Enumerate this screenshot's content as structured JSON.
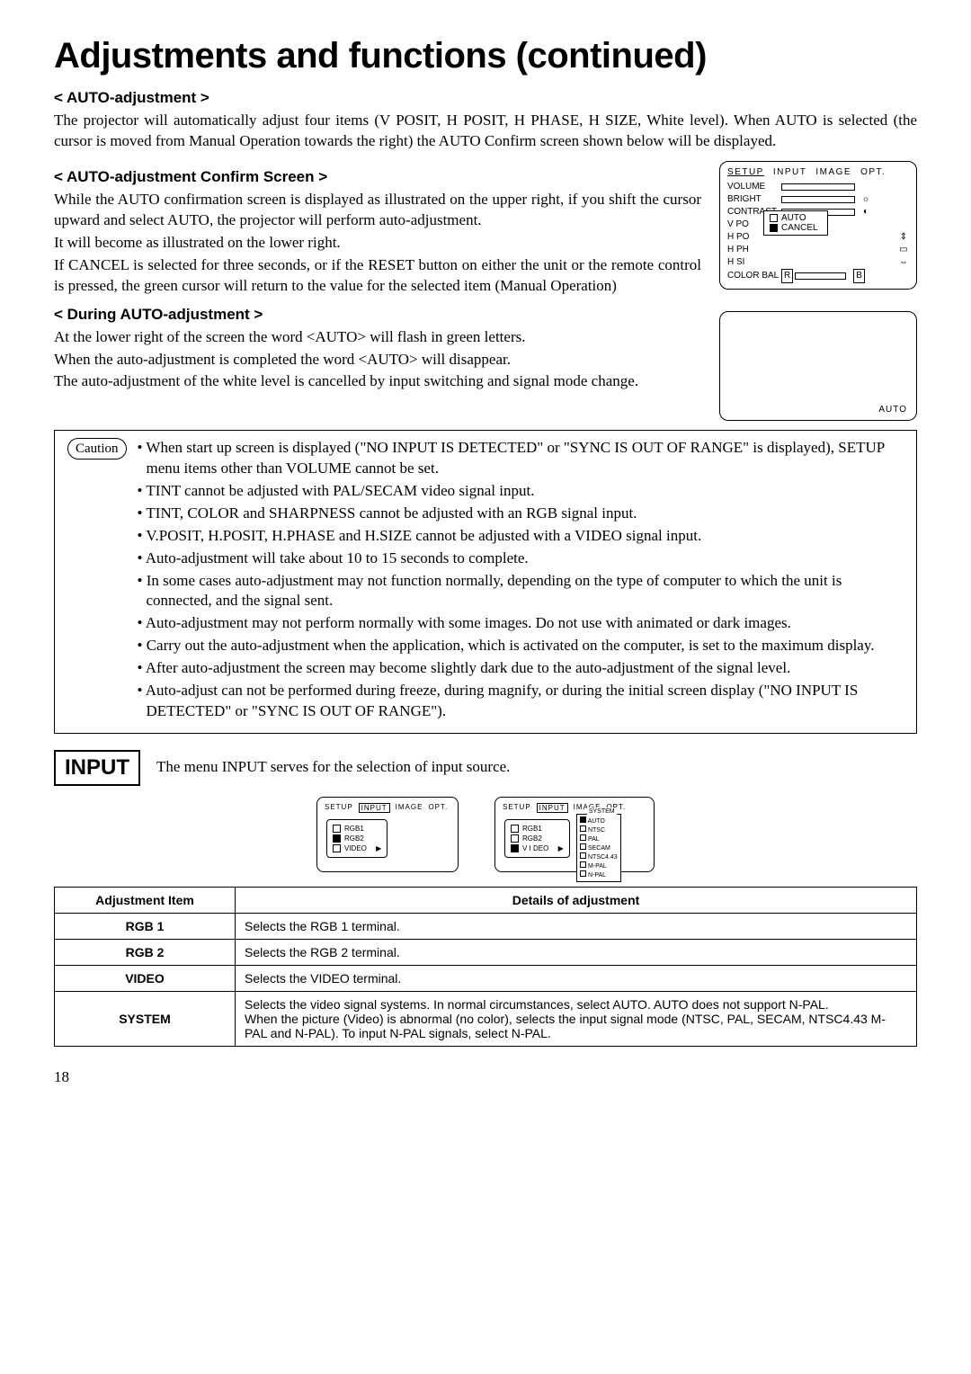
{
  "page": {
    "title": "Adjustments and functions (continued)",
    "number": "18"
  },
  "sections": {
    "auto_adj": {
      "heading": "< AUTO-adjustment >",
      "p1": "The projector will automatically adjust four items (V POSIT, H POSIT, H PHASE, H SIZE, White level). When AUTO is selected (the cursor is moved from Manual Operation towards the right) the AUTO Confirm screen shown below will be displayed."
    },
    "confirm": {
      "heading": "< AUTO-adjustment  Confirm Screen >",
      "p1": "While the AUTO confirmation screen is displayed as illustrated on the upper right, if you shift the cursor upward and select AUTO, the projector will perform auto-adjustment.",
      "p2": "It will become as illustrated on the lower right.",
      "p3": "If CANCEL is selected for three seconds, or if the RESET button on either the unit or the remote control is pressed, the green cursor will return to the value for the selected item (Manual Operation)"
    },
    "during": {
      "heading": "< During AUTO-adjustment >",
      "p1": "At the lower right of the screen the word <AUTO> will flash in green letters.",
      "p2": "When the auto-adjustment is completed the word <AUTO> will disappear.",
      "p3": "The auto-adjustment of the white level is cancelled by input switching and signal mode change."
    }
  },
  "osd": {
    "tabs": [
      "SETUP",
      "INPUT",
      "IMAGE",
      "OPT."
    ],
    "rows": {
      "volume": "VOLUME",
      "bright": "BRIGHT",
      "contrast": "CONTRAST",
      "vpo": "V PO",
      "hpo": "H PO",
      "hph": "H PH",
      "hsi": "H SI",
      "colorbal": "COLOR BAL",
      "r": "R",
      "b": "B"
    },
    "popup": {
      "auto": "AUTO",
      "cancel": "CANCEL"
    },
    "status_label": "AUTO"
  },
  "caution": {
    "label": "Caution",
    "items": [
      "When start up screen is displayed (\"NO INPUT IS DETECTED\" or \"SYNC IS OUT OF RANGE\" is displayed), SETUP menu items other than VOLUME cannot be set.",
      "TINT cannot be adjusted with PAL/SECAM video signal input.",
      "TINT, COLOR and SHARPNESS cannot be adjusted with an RGB signal input.",
      "V.POSIT, H.POSIT, H.PHASE and H.SIZE cannot be adjusted with a VIDEO signal input.",
      "Auto-adjustment will take about 10 to 15 seconds to complete.",
      "In some cases auto-adjustment may not function normally, depending on the type of computer to which the unit is connected, and the signal sent.",
      "Auto-adjustment may not perform normally with some images. Do not use with animated or dark images.",
      "Carry out the auto-adjustment when the application, which is activated on the computer, is set to the maximum display.",
      "After auto-adjustment the screen may become slightly dark due to the auto-adjustment of the signal level.",
      "Auto-adjust can not be performed during freeze, during magnify, or during the initial screen display (\"NO INPUT IS DETECTED\" or \"SYNC IS OUT OF RANGE\")."
    ]
  },
  "input": {
    "badge": "INPUT",
    "intro": "The menu INPUT serves for the selection of input source.",
    "mini": {
      "rgb1": "RGB1",
      "rgb2": "RGB2",
      "video": "VIDEO",
      "video2": "V I DEO",
      "arrow": "▶",
      "system": "SYSTEM",
      "sys_items": [
        "AUTO",
        "NTSC",
        "PAL",
        "SECAM",
        "NTSC4.43",
        "M-PAL",
        "N-PAL"
      ]
    },
    "table": {
      "h1": "Adjustment Item",
      "h2": "Details of adjustment",
      "rows": [
        {
          "name": "RGB 1",
          "detail": "Selects the RGB 1 terminal."
        },
        {
          "name": "RGB 2",
          "detail": "Selects the RGB 2 terminal."
        },
        {
          "name": "VIDEO",
          "detail": "Selects the VIDEO terminal."
        },
        {
          "name": "SYSTEM",
          "detail": "Selects the video signal systems. In normal circumstances, select AUTO. AUTO does not support N-PAL.\nWhen the picture (Video) is abnormal (no color), selects the input signal mode (NTSC, PAL, SECAM, NTSC4.43 M-PAL and N-PAL). To input N-PAL signals, select N-PAL."
        }
      ]
    }
  }
}
